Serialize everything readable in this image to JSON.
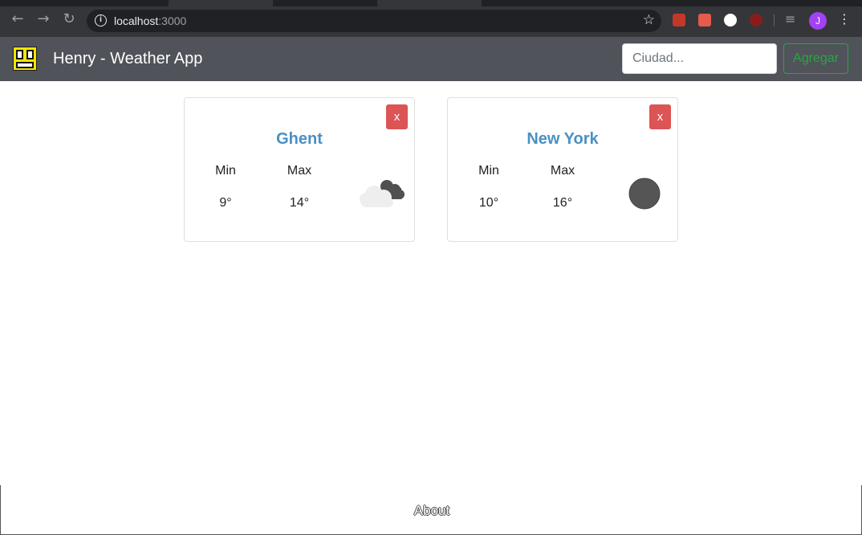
{
  "browser": {
    "url_host": "localhost",
    "url_port": ":3000",
    "profile_initial": "J"
  },
  "app": {
    "brand": "Henry - Weather App",
    "search_placeholder": "Ciudad...",
    "add_label": "Agregar"
  },
  "cards": [
    {
      "city": "Ghent",
      "min_label": "Min",
      "max_label": "Max",
      "min": "9°",
      "max": "14°",
      "close_label": "x",
      "icon": "cloudy-night-icon"
    },
    {
      "city": "New York",
      "min_label": "Min",
      "max_label": "Max",
      "min": "10°",
      "max": "16°",
      "close_label": "x",
      "icon": "moon-icon"
    }
  ],
  "footer": {
    "about": "About"
  }
}
